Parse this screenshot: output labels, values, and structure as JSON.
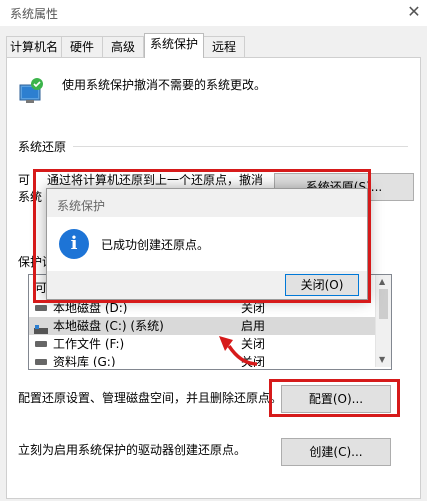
{
  "window": {
    "title": "系统属性",
    "close_glyph": "✕"
  },
  "tabs": [
    {
      "label": "计算机名"
    },
    {
      "label": "硬件"
    },
    {
      "label": "高级"
    },
    {
      "label": "系统保护",
      "active": true
    },
    {
      "label": "远程"
    }
  ],
  "intro": {
    "text": "使用系统保护撤消不需要的系统更改。",
    "icon": "system-protection-icon"
  },
  "restore": {
    "heading": "系统还原",
    "line1": "可",
    "line1b": "通过将计算机还原到上一个还原点，撤消",
    "line2": "系统",
    "button": "系统还原(S)..."
  },
  "protection": {
    "heading": "保护设",
    "list_header_fragment": "可",
    "drives": [
      {
        "name": "本地磁盘 (D:)",
        "status": "关闭",
        "icon": "drive-icon"
      },
      {
        "name": "本地磁盘 (C:) (系统)",
        "status": "启用",
        "icon": "system-drive-icon",
        "selected": true
      },
      {
        "name": "工作文件 (F:)",
        "status": "关闭",
        "icon": "drive-icon"
      },
      {
        "name": "资料库 (G:)",
        "status": "关闭",
        "icon": "drive-icon"
      }
    ]
  },
  "configure": {
    "text": "配置还原设置、管理磁盘空间，并且删除还原点。",
    "button": "配置(O)..."
  },
  "create": {
    "text": "立刻为启用系统保护的驱动器创建还原点。",
    "button": "创建(C)..."
  },
  "dialog": {
    "title": "系统保护",
    "message": "已成功创建还原点。",
    "icon": "info-icon",
    "icon_glyph": "i",
    "close_button": "关闭(O)"
  },
  "colors": {
    "highlight_red": "#d61a1a",
    "info_blue": "#1d74d6"
  }
}
